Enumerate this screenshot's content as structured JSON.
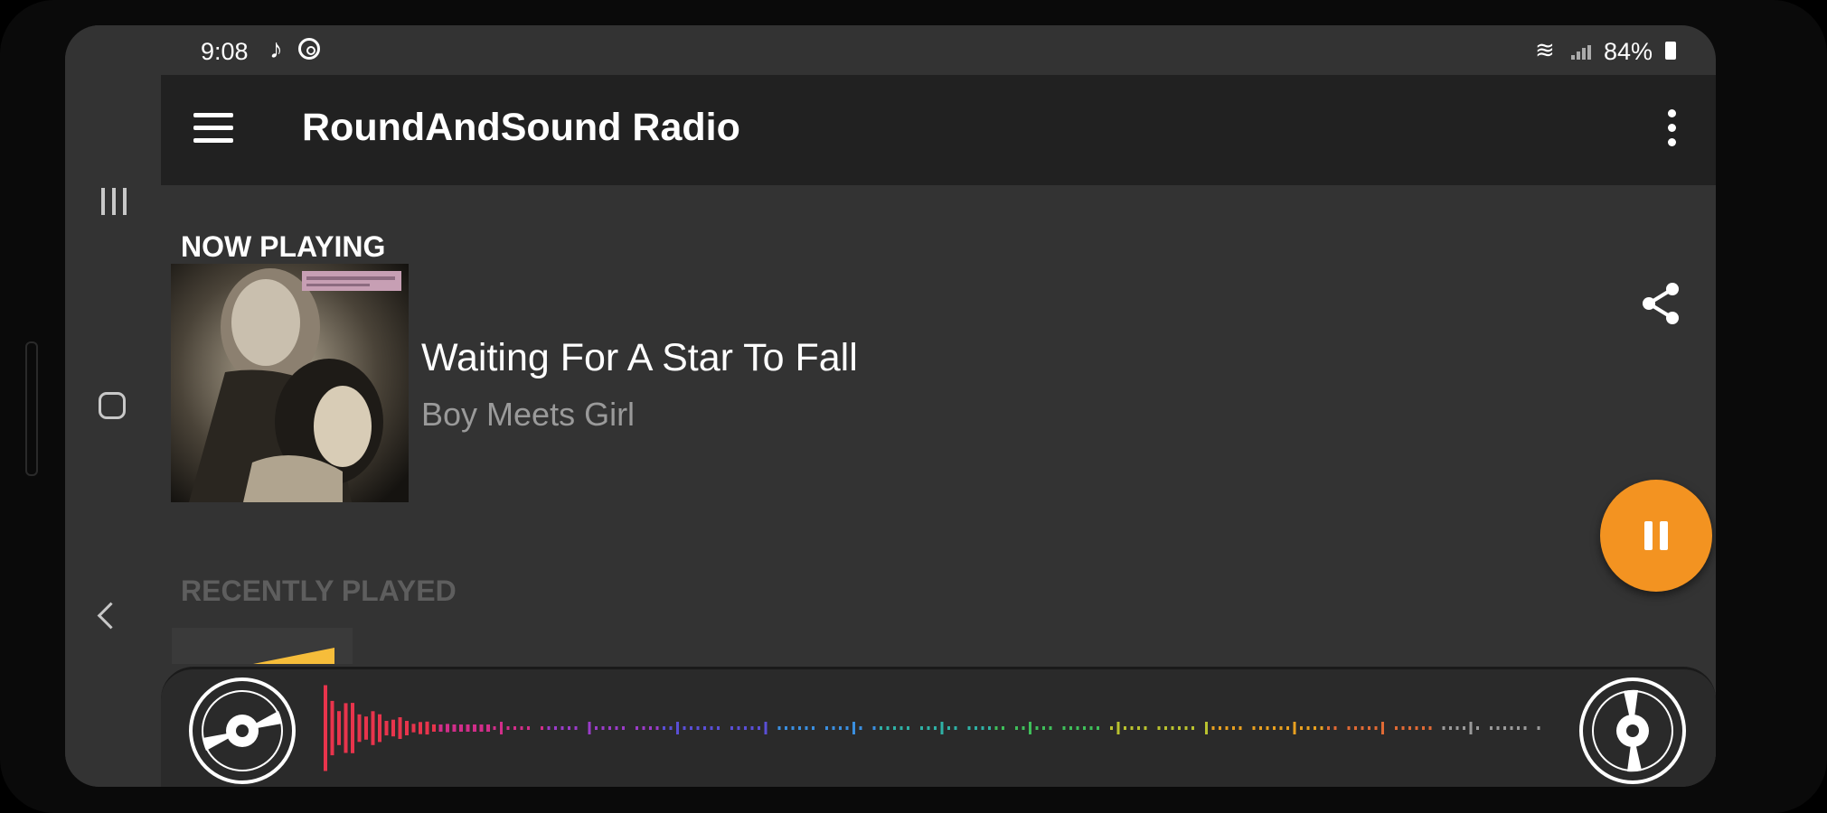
{
  "status_bar": {
    "time": "9:08",
    "battery": "84%",
    "icons": [
      "music-note-icon",
      "cast-icon",
      "wifi-icon",
      "signal-icon",
      "battery-icon"
    ]
  },
  "system_nav": [
    "recents-icon",
    "home-icon",
    "back-icon"
  ],
  "toolbar": {
    "title": "RoundAndSound Radio",
    "menu_icon": "hamburger-menu-icon",
    "overflow_icon": "more-vert-icon"
  },
  "now_playing": {
    "section_label": "NOW PLAYING",
    "track_title": "Waiting For A Star To Fall",
    "artist": "Boy Meets Girl",
    "share_icon": "share-icon"
  },
  "recently_played": {
    "section_label": "RECENTLY PLAYED"
  },
  "fab": {
    "icon": "pause-icon",
    "color": "#f39321"
  },
  "player_bar": {
    "left_icon": "vinyl-disc-icon",
    "right_icon": "vinyl-disc-icon",
    "visualizer_colors": [
      "#e8344c",
      "#d22e8a",
      "#9b3cc9",
      "#5a4fd6",
      "#3a8fe0",
      "#2fb1a5",
      "#3fbf5a",
      "#b9c22f",
      "#e8a020",
      "#e06a35",
      "#9a9a9a"
    ]
  },
  "colors": {
    "background": "#333333",
    "toolbar": "#212121",
    "accent": "#f39321"
  }
}
